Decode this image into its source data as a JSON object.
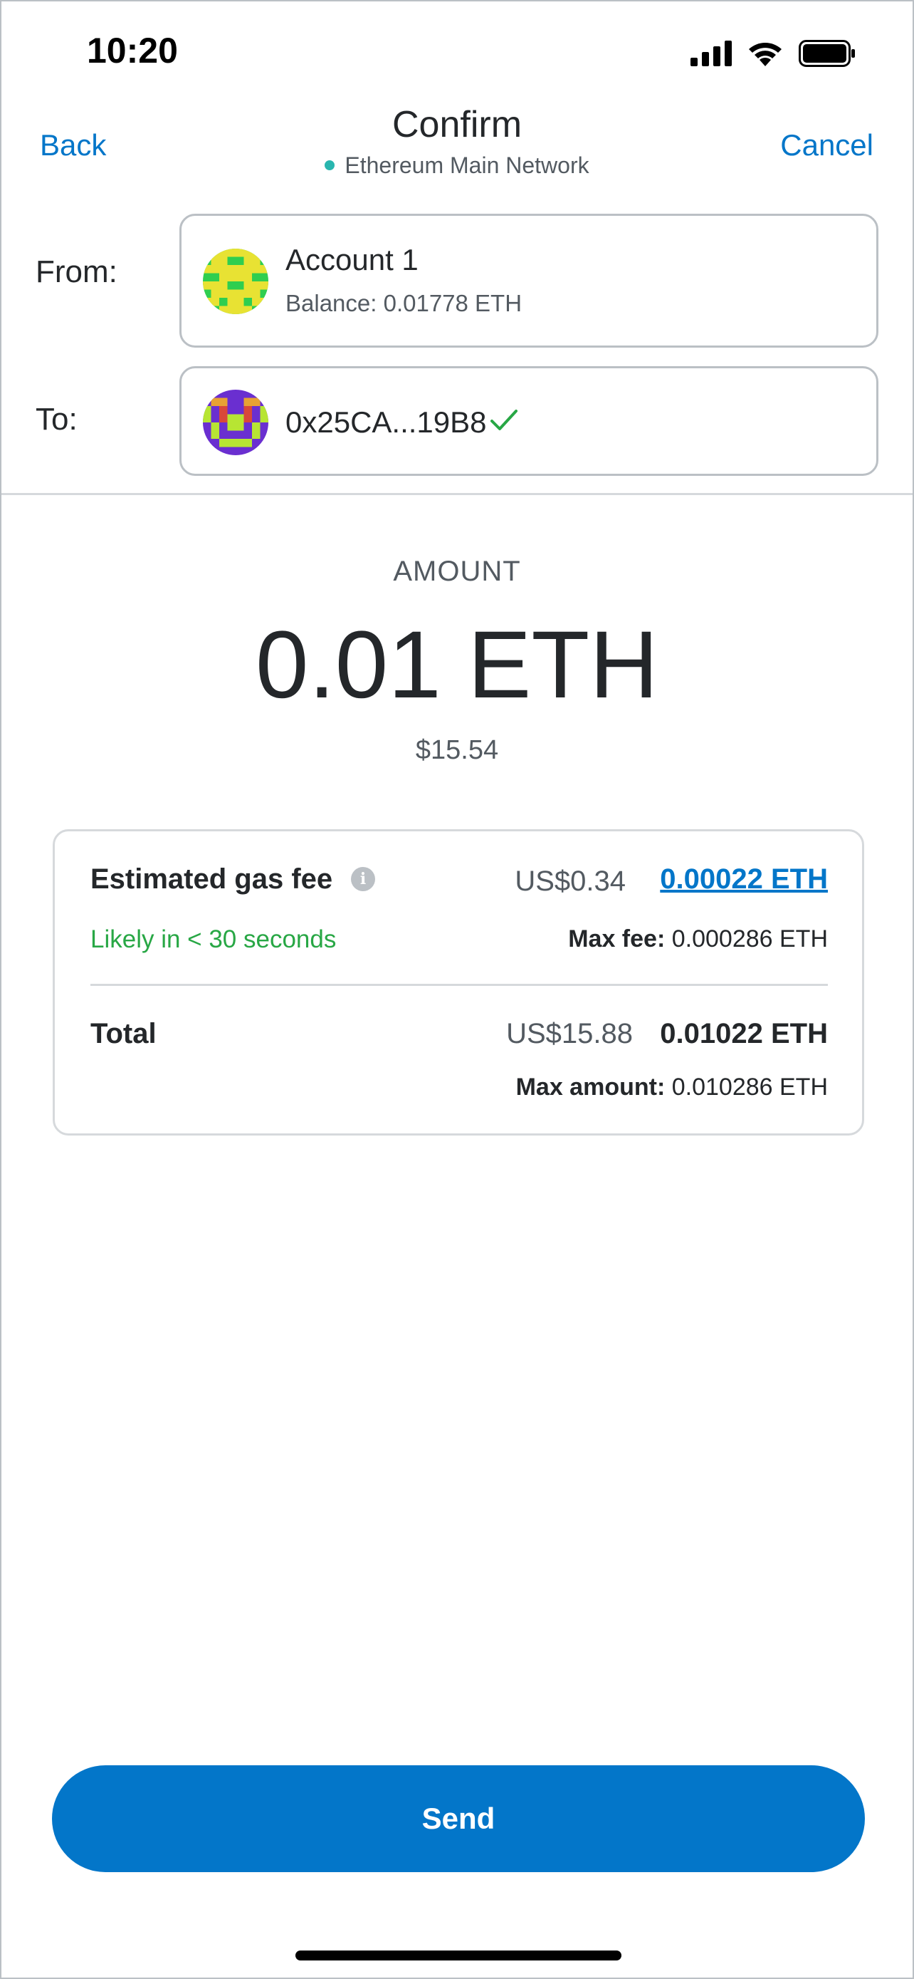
{
  "status_bar": {
    "time": "10:20"
  },
  "header": {
    "back_label": "Back",
    "title": "Confirm",
    "network": "Ethereum Main Network",
    "cancel_label": "Cancel"
  },
  "from": {
    "label": "From:",
    "account_name": "Account 1",
    "balance": "Balance: 0.01778 ETH"
  },
  "to": {
    "label": "To:",
    "address": "0x25CA...19B8"
  },
  "amount": {
    "label": "AMOUNT",
    "value": "0.01 ETH",
    "fiat": "$15.54"
  },
  "fee": {
    "label": "Estimated gas fee",
    "fiat": "US$0.34",
    "eth": "0.00022 ETH",
    "likely": "Likely in < 30 seconds",
    "max_fee_label": "Max fee:",
    "max_fee_value": "0.000286 ETH"
  },
  "total": {
    "label": "Total",
    "fiat": "US$15.88",
    "eth": "0.01022 ETH",
    "max_amount_label": "Max amount:",
    "max_amount_value": "0.010286 ETH"
  },
  "send_label": "Send",
  "colors": {
    "accent": "#0376c9",
    "success": "#28a745",
    "network_dot": "#29b6af"
  }
}
